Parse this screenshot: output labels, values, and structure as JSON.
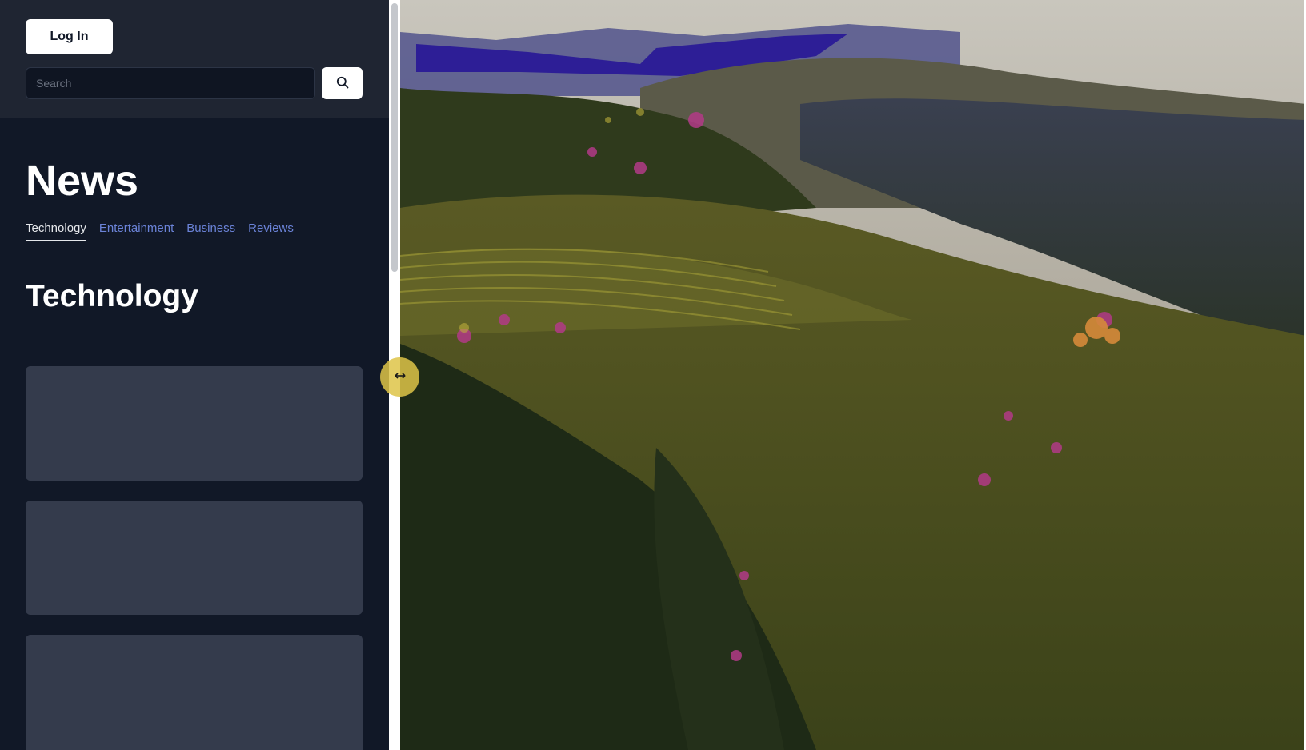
{
  "header": {
    "login_label": "Log In",
    "search_placeholder": "Search",
    "search_icon": "search-icon"
  },
  "main": {
    "title": "News",
    "tabs": [
      {
        "label": "Technology",
        "active": true
      },
      {
        "label": "Entertainment",
        "active": false
      },
      {
        "label": "Business",
        "active": false
      },
      {
        "label": "Reviews",
        "active": false
      }
    ],
    "section_title": "Technology",
    "card_count": 3
  },
  "splitter": {
    "icon": "resize-arrows-icon"
  },
  "colors": {
    "sidebar_bg": "#111827",
    "topbar_bg": "#1f2532",
    "card_bg": "#343b4c",
    "tab_link": "#6b83d8",
    "handle": "#dec448"
  }
}
